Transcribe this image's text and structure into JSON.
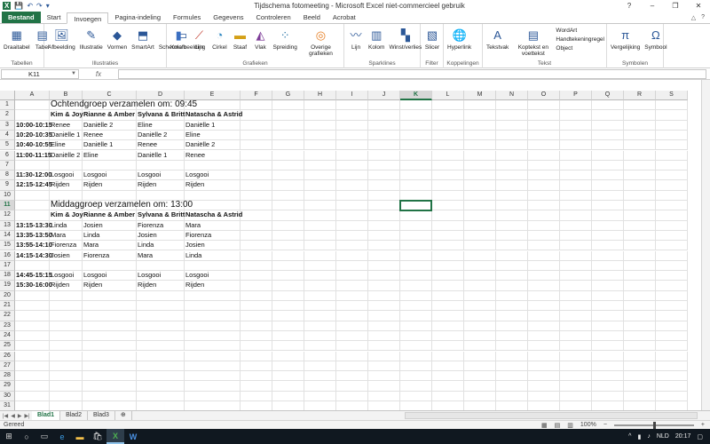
{
  "window": {
    "title": "Tijdschema fotomeeting - Microsoft Excel niet-commercieel gebruik",
    "qat": [
      "excel-icon",
      "save-icon",
      "undo-icon",
      "redo-icon",
      "customize-icon"
    ],
    "controls": {
      "help": "?",
      "minimize": "–",
      "restore": "❐",
      "close": "✕"
    }
  },
  "tabs": {
    "file": "Bestand",
    "items": [
      "Start",
      "Invoegen",
      "Pagina-indeling",
      "Formules",
      "Gegevens",
      "Controleren",
      "Beeld",
      "Acrobat"
    ],
    "active": "Invoegen"
  },
  "ribbon": {
    "groups": [
      {
        "label": "Tabellen",
        "buttons": [
          {
            "label": "Draaitabel",
            "icon": "pivot-icon"
          },
          {
            "label": "Tabel",
            "icon": "table-icon"
          }
        ]
      },
      {
        "label": "Illustraties",
        "buttons": [
          {
            "label": "Afbeelding",
            "icon": "picture-icon"
          },
          {
            "label": "Illustratie",
            "icon": "clipart-icon"
          },
          {
            "label": "Vormen",
            "icon": "shapes-icon"
          },
          {
            "label": "SmartArt",
            "icon": "smartart-icon"
          },
          {
            "label": "Schermafbeelding",
            "icon": "screenshot-icon"
          }
        ]
      },
      {
        "label": "Grafieken",
        "buttons": [
          {
            "label": "Kolom",
            "icon": "column-chart-icon"
          },
          {
            "label": "Lijn",
            "icon": "line-chart-icon"
          },
          {
            "label": "Cirkel",
            "icon": "pie-chart-icon"
          },
          {
            "label": "Staaf",
            "icon": "bar-chart-icon"
          },
          {
            "label": "Vlak",
            "icon": "area-chart-icon"
          },
          {
            "label": "Spreiding",
            "icon": "scatter-chart-icon"
          },
          {
            "label": "Overige grafieken",
            "icon": "other-charts-icon"
          }
        ]
      },
      {
        "label": "Sparklines",
        "buttons": [
          {
            "label": "Lijn",
            "icon": "sparkline-line-icon"
          },
          {
            "label": "Kolom",
            "icon": "sparkline-column-icon"
          },
          {
            "label": "Winst/verlies",
            "icon": "sparkline-winloss-icon"
          }
        ]
      },
      {
        "label": "Filter",
        "buttons": [
          {
            "label": "Slicer",
            "icon": "slicer-icon"
          }
        ]
      },
      {
        "label": "Koppelingen",
        "buttons": [
          {
            "label": "Hyperlink",
            "icon": "hyperlink-icon"
          }
        ]
      },
      {
        "label": "Tekst",
        "buttons": [
          {
            "label": "Tekstvak",
            "icon": "textbox-icon"
          },
          {
            "label": "Koptekst en voettekst",
            "icon": "header-footer-icon"
          }
        ],
        "small": [
          "WordArt",
          "Handtekeningregel",
          "Object"
        ]
      },
      {
        "label": "Symbolen",
        "buttons": [
          {
            "label": "Vergelijking",
            "icon": "equation-icon"
          },
          {
            "label": "Symbool",
            "icon": "symbol-icon"
          }
        ]
      }
    ]
  },
  "formula_bar": {
    "name_box": "K11",
    "fx": "fx",
    "value": ""
  },
  "columns": [
    "A",
    "B",
    "C",
    "D",
    "E",
    "F",
    "G",
    "H",
    "I",
    "J",
    "K",
    "L",
    "M",
    "N",
    "O",
    "P",
    "Q",
    "R",
    "S"
  ],
  "selected": {
    "col": "K",
    "row": 11
  },
  "rows": 31,
  "cells": [
    {
      "r": 1,
      "c": "B",
      "v": "Ochtendgroep verzamelen om: 09:45",
      "style": "big"
    },
    {
      "r": 2,
      "c": "B",
      "v": "Kim & Joy",
      "style": "b"
    },
    {
      "r": 2,
      "c": "C",
      "v": "Rianne & Amber",
      "style": "b"
    },
    {
      "r": 2,
      "c": "D",
      "v": "Sylvana & Britt",
      "style": "b"
    },
    {
      "r": 2,
      "c": "E",
      "v": "Natascha & Astrid",
      "style": "b"
    },
    {
      "r": 3,
      "c": "A",
      "v": "10:00-10:15",
      "style": "b"
    },
    {
      "r": 3,
      "c": "B",
      "v": "Renee"
    },
    {
      "r": 3,
      "c": "C",
      "v": "Daniëlle 2"
    },
    {
      "r": 3,
      "c": "D",
      "v": "Eline"
    },
    {
      "r": 3,
      "c": "E",
      "v": "Daniëlle 1"
    },
    {
      "r": 4,
      "c": "A",
      "v": "10:20-10:35",
      "style": "b"
    },
    {
      "r": 4,
      "c": "B",
      "v": "Daniëlle 1"
    },
    {
      "r": 4,
      "c": "C",
      "v": "Renee"
    },
    {
      "r": 4,
      "c": "D",
      "v": "Daniëlle 2"
    },
    {
      "r": 4,
      "c": "E",
      "v": "Eline"
    },
    {
      "r": 5,
      "c": "A",
      "v": "10:40-10:55",
      "style": "b"
    },
    {
      "r": 5,
      "c": "B",
      "v": "Eline"
    },
    {
      "r": 5,
      "c": "C",
      "v": "Daniëlle 1"
    },
    {
      "r": 5,
      "c": "D",
      "v": "Renee"
    },
    {
      "r": 5,
      "c": "E",
      "v": "Daniëlle 2"
    },
    {
      "r": 6,
      "c": "A",
      "v": "11:00-11:15",
      "style": "b"
    },
    {
      "r": 6,
      "c": "B",
      "v": "Daniëlle 2"
    },
    {
      "r": 6,
      "c": "C",
      "v": "Eline"
    },
    {
      "r": 6,
      "c": "D",
      "v": "Daniëlle 1"
    },
    {
      "r": 6,
      "c": "E",
      "v": "Renee"
    },
    {
      "r": 8,
      "c": "A",
      "v": "11:30-12:00",
      "style": "b"
    },
    {
      "r": 8,
      "c": "B",
      "v": "Losgooi"
    },
    {
      "r": 8,
      "c": "C",
      "v": "Losgooi"
    },
    {
      "r": 8,
      "c": "D",
      "v": "Losgooi"
    },
    {
      "r": 8,
      "c": "E",
      "v": "Losgooi"
    },
    {
      "r": 9,
      "c": "A",
      "v": "12:15-12:45",
      "style": "b"
    },
    {
      "r": 9,
      "c": "B",
      "v": "Rijden"
    },
    {
      "r": 9,
      "c": "C",
      "v": "Rijden"
    },
    {
      "r": 9,
      "c": "D",
      "v": "Rijden"
    },
    {
      "r": 9,
      "c": "E",
      "v": "Rijden"
    },
    {
      "r": 11,
      "c": "B",
      "v": "Middaggroep verzamelen om: 13:00",
      "style": "big"
    },
    {
      "r": 12,
      "c": "B",
      "v": "Kim & Joy",
      "style": "b"
    },
    {
      "r": 12,
      "c": "C",
      "v": "Rianne & Amber",
      "style": "b"
    },
    {
      "r": 12,
      "c": "D",
      "v": "Sylvana & Britt",
      "style": "b"
    },
    {
      "r": 12,
      "c": "E",
      "v": "Natascha & Astrid",
      "style": "b"
    },
    {
      "r": 13,
      "c": "A",
      "v": "13:15-13:30",
      "style": "b"
    },
    {
      "r": 13,
      "c": "B",
      "v": "Linda"
    },
    {
      "r": 13,
      "c": "C",
      "v": "Josien"
    },
    {
      "r": 13,
      "c": "D",
      "v": "Fiorenza"
    },
    {
      "r": 13,
      "c": "E",
      "v": "Mara"
    },
    {
      "r": 14,
      "c": "A",
      "v": "13:35-13:50",
      "style": "b"
    },
    {
      "r": 14,
      "c": "B",
      "v": "Mara"
    },
    {
      "r": 14,
      "c": "C",
      "v": "Linda"
    },
    {
      "r": 14,
      "c": "D",
      "v": "Josien"
    },
    {
      "r": 14,
      "c": "E",
      "v": "Fiorenza"
    },
    {
      "r": 15,
      "c": "A",
      "v": "13:55-14:10",
      "style": "b"
    },
    {
      "r": 15,
      "c": "B",
      "v": "Fiorenza"
    },
    {
      "r": 15,
      "c": "C",
      "v": "Mara"
    },
    {
      "r": 15,
      "c": "D",
      "v": "Linda"
    },
    {
      "r": 15,
      "c": "E",
      "v": "Josien"
    },
    {
      "r": 16,
      "c": "A",
      "v": "14:15-14:30",
      "style": "b"
    },
    {
      "r": 16,
      "c": "B",
      "v": "Josien"
    },
    {
      "r": 16,
      "c": "C",
      "v": "Fiorenza"
    },
    {
      "r": 16,
      "c": "D",
      "v": "Mara"
    },
    {
      "r": 16,
      "c": "E",
      "v": "Linda"
    },
    {
      "r": 18,
      "c": "A",
      "v": "14:45-15:15",
      "style": "b"
    },
    {
      "r": 18,
      "c": "B",
      "v": "Losgooi"
    },
    {
      "r": 18,
      "c": "C",
      "v": "Losgooi"
    },
    {
      "r": 18,
      "c": "D",
      "v": "Losgooi"
    },
    {
      "r": 18,
      "c": "E",
      "v": "Losgooi"
    },
    {
      "r": 19,
      "c": "A",
      "v": "15:30-16:00",
      "style": "b"
    },
    {
      "r": 19,
      "c": "B",
      "v": "Rijden"
    },
    {
      "r": 19,
      "c": "C",
      "v": "Rijden"
    },
    {
      "r": 19,
      "c": "D",
      "v": "Rijden"
    },
    {
      "r": 19,
      "c": "E",
      "v": "Rijden"
    }
  ],
  "sheets": {
    "items": [
      "Blad1",
      "Blad2",
      "Blad3"
    ],
    "active": "Blad1"
  },
  "status": {
    "left": "Gereed",
    "zoom": "100%"
  },
  "taskbar": {
    "time": "20:17",
    "lang": "NLD",
    "apps": [
      "windows-icon",
      "search-icon",
      "taskview-icon",
      "edge-icon",
      "explorer-icon",
      "store-icon",
      "excel-icon",
      "word-icon"
    ]
  },
  "colors": {
    "accent": "#217346",
    "taskbar": "#101820"
  }
}
